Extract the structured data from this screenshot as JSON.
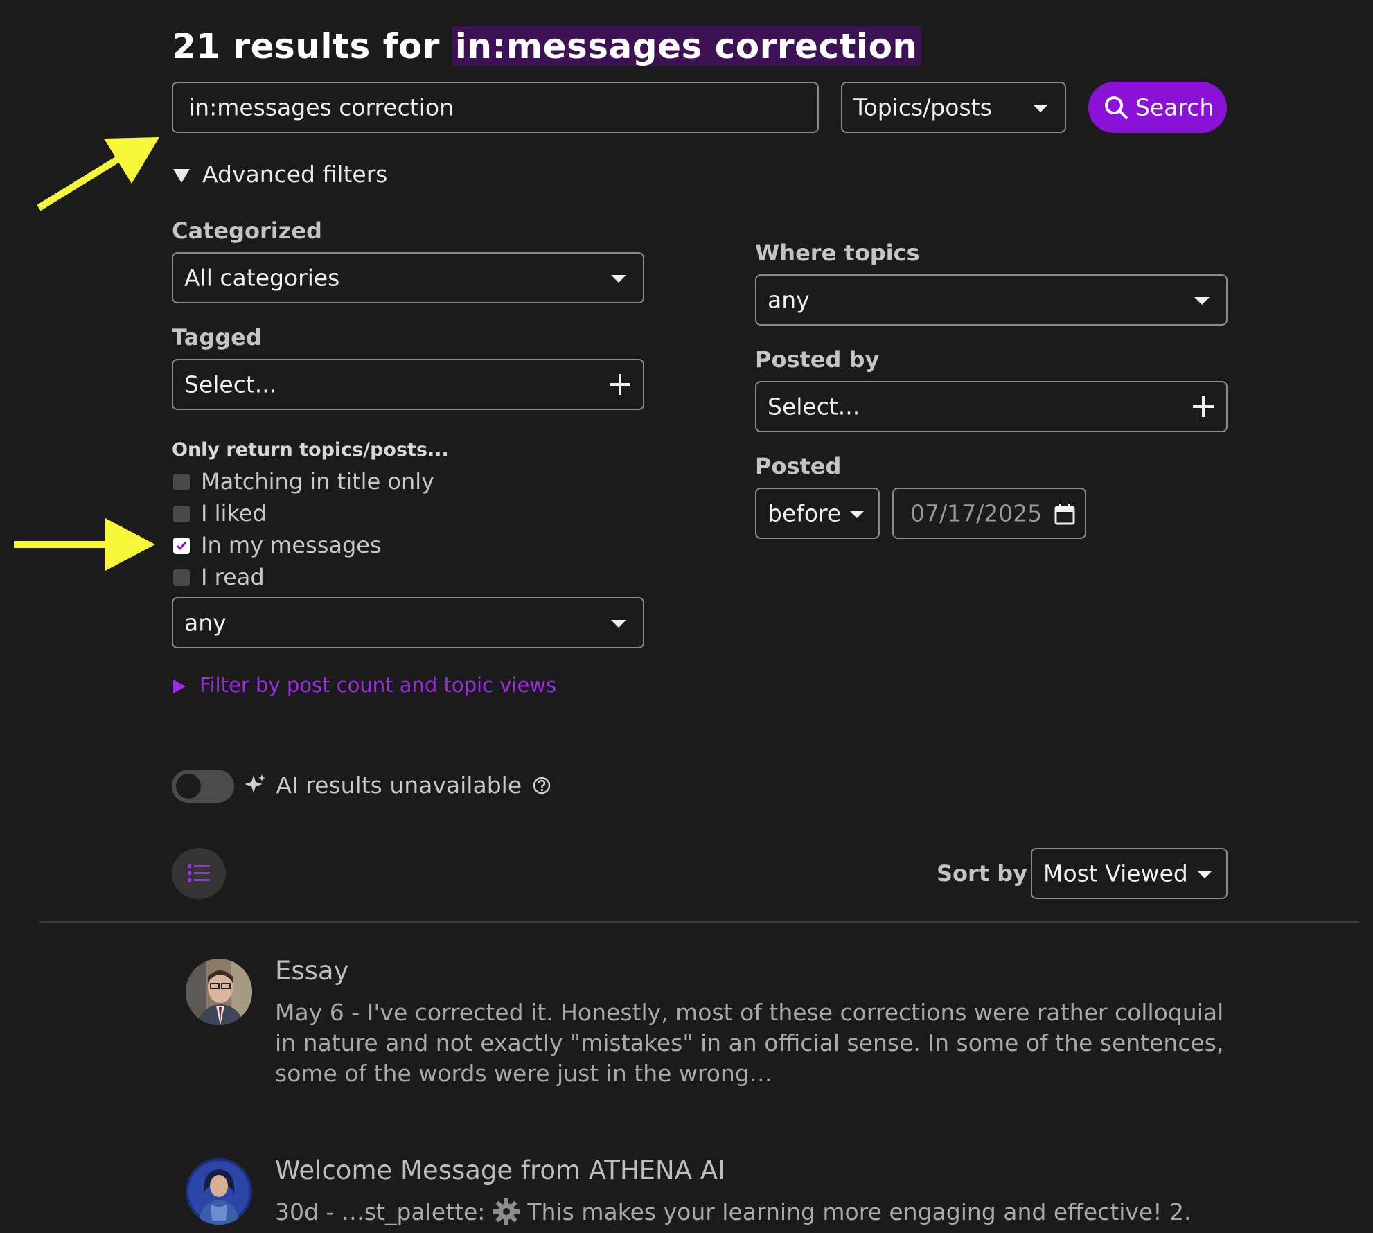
{
  "header": {
    "title_prefix": "21 results for ",
    "title_query": "in:messages correction"
  },
  "search": {
    "input_value": "in:messages correction",
    "type_select": "Topics/posts",
    "button_label": "Search"
  },
  "advanced": {
    "toggle_label": "Advanced filters",
    "categorized_label": "Categorized",
    "categorized_value": "All categories",
    "tagged_label": "Tagged",
    "tagged_placeholder": "Select...",
    "only_return_label": "Only return topics/posts...",
    "checkboxes": [
      {
        "label": "Matching in title only",
        "checked": false
      },
      {
        "label": "I liked",
        "checked": false
      },
      {
        "label": "In my messages",
        "checked": true
      },
      {
        "label": "I read",
        "checked": false
      }
    ],
    "status_select": "any",
    "filter_link": "Filter by post count and topic views",
    "where_topics_label": "Where topics",
    "where_topics_value": "any",
    "posted_by_label": "Posted by",
    "posted_by_placeholder": "Select...",
    "posted_label": "Posted",
    "posted_when": "before",
    "posted_date": "07/17/2025"
  },
  "ai": {
    "label": "AI results unavailable"
  },
  "sort": {
    "label": "Sort by",
    "value": "Most Viewed"
  },
  "results": [
    {
      "title": "Essay",
      "date": "May 6",
      "separator": " - ",
      "blurb": "I've corrected it. Honestly, most of these corrections were rather colloquial in nature and not exactly \"mistakes\" in an official sense. In some of the sentences, some of the words were just in the wrong…"
    },
    {
      "title": "Welcome Message from ATHENA AI",
      "date": "30d",
      "separator": " - ",
      "blurb_before": "…st_palette: ",
      "blurb_after": " This makes your learning more engaging and effective! 2."
    }
  ],
  "colors": {
    "background": "#1b1b1b",
    "accent": "#8a12d6",
    "link": "#9b2ee0",
    "annotation_arrow": "#f7f73a"
  },
  "icons": [
    "search-icon",
    "caret-down-icon",
    "plus-icon",
    "calendar-icon",
    "sparkle-icon",
    "help-circle-icon",
    "list-icon",
    "gear-icon"
  ]
}
